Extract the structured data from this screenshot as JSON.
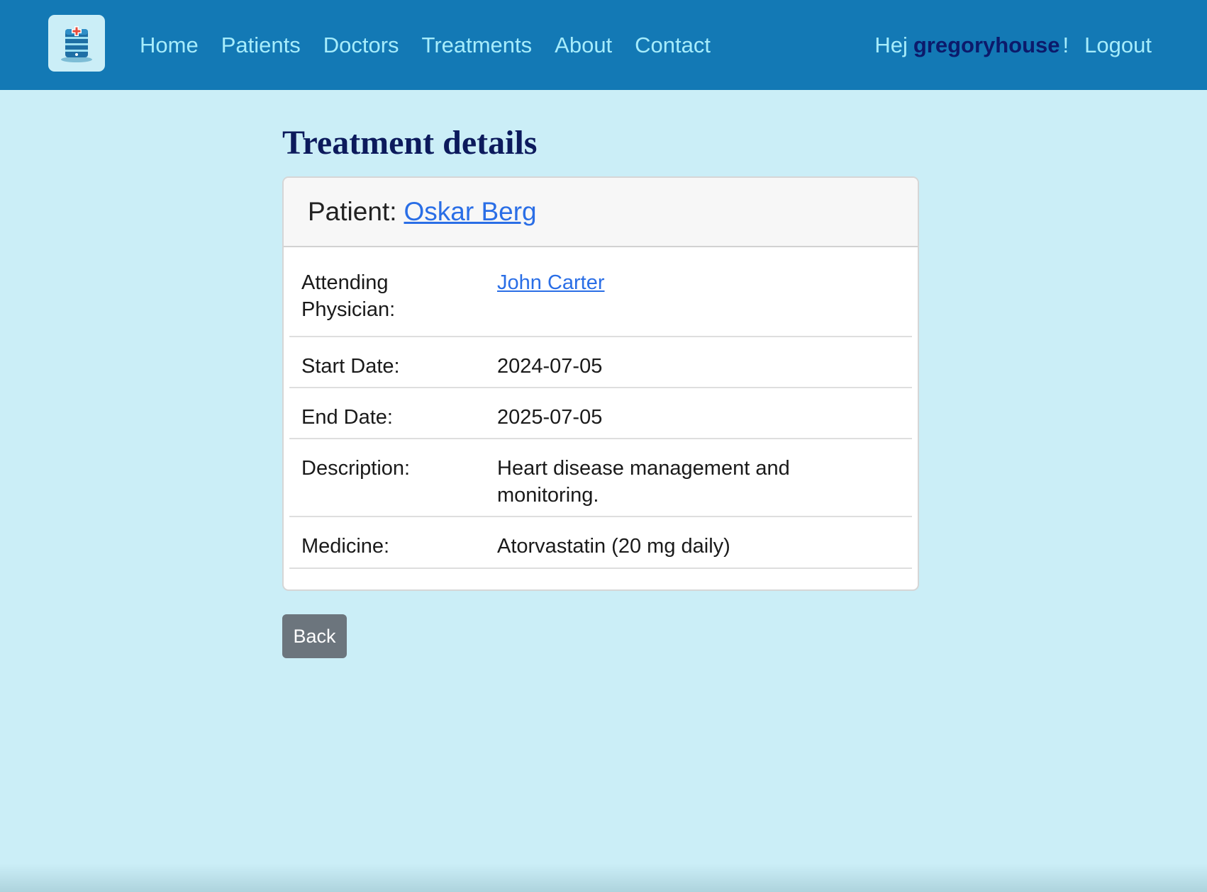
{
  "nav": {
    "items": [
      {
        "id": "home",
        "label": "Home"
      },
      {
        "id": "patients",
        "label": "Patients"
      },
      {
        "id": "doctors",
        "label": "Doctors"
      },
      {
        "id": "treatments",
        "label": "Treatments"
      },
      {
        "id": "about",
        "label": "About"
      },
      {
        "id": "contact",
        "label": "Contact"
      }
    ],
    "greeting": "Hej",
    "username": "gregoryhouse",
    "exclamation": "!",
    "logout_label": "Logout",
    "logo_icon": "hospital-database-icon"
  },
  "page": {
    "title": "Treatment details"
  },
  "card": {
    "patient_label": "Patient:",
    "patient_name": "Oskar Berg",
    "rows": [
      {
        "label": "Attending Physician:",
        "value": "John Carter",
        "is_link": true
      },
      {
        "label": "Start Date:",
        "value": "2024-07-05",
        "is_link": false
      },
      {
        "label": "End Date:",
        "value": "2025-07-05",
        "is_link": false
      },
      {
        "label": "Description:",
        "value": "Heart disease management and monitoring.",
        "is_link": false
      },
      {
        "label": "Medicine:",
        "value": "Atorvastatin (20 mg daily)",
        "is_link": false
      }
    ]
  },
  "actions": {
    "back_label": "Back"
  },
  "colors": {
    "navbar": "#1379b5",
    "background": "#cbeef7",
    "nav_link": "#a6ecfb",
    "title": "#0c1a5c",
    "link": "#2a6ee6",
    "back_button": "#6c757d"
  }
}
